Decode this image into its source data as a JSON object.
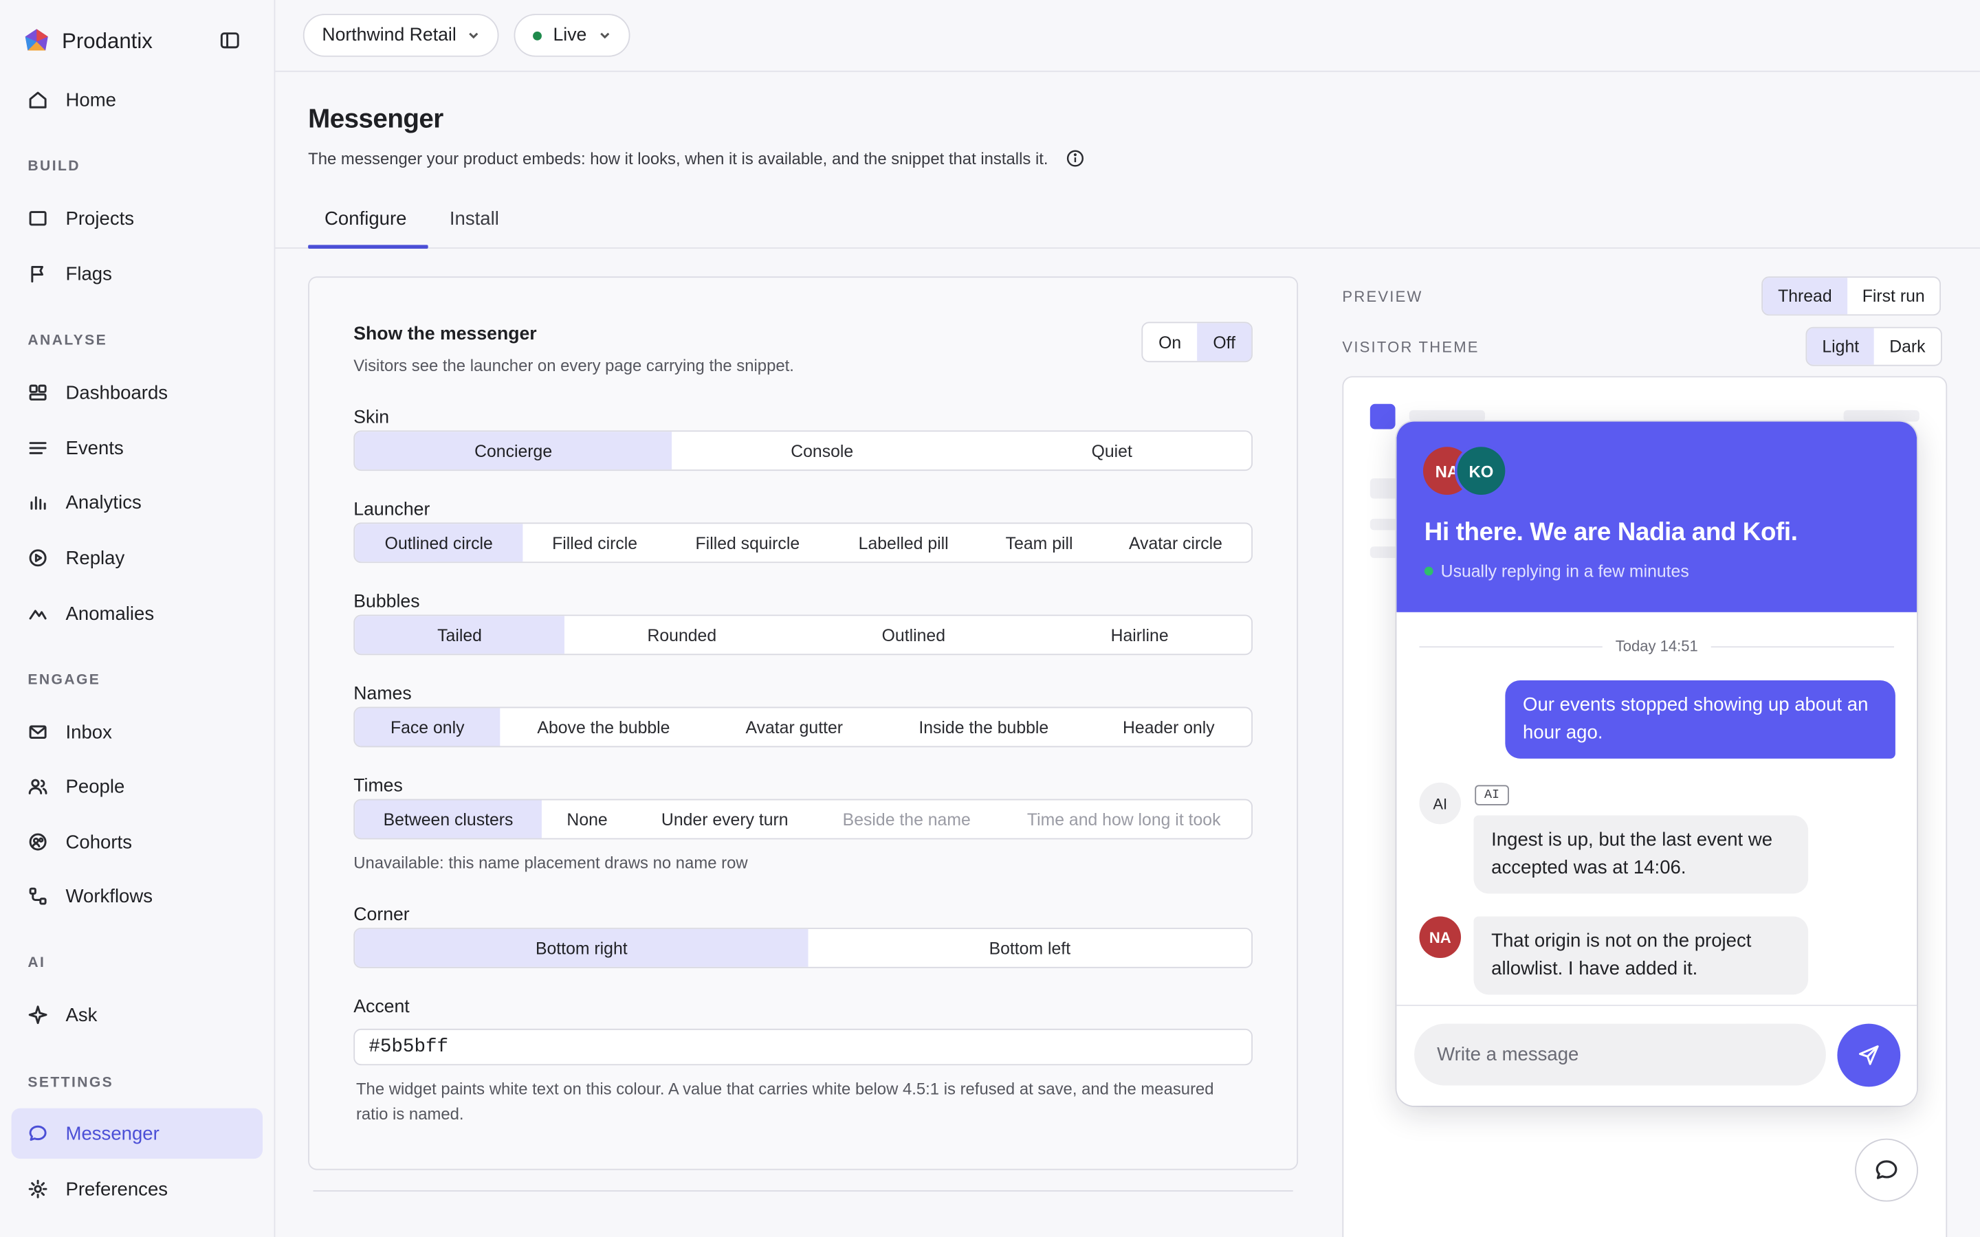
{
  "app": {
    "name": "Prodantix"
  },
  "sidebar": {
    "home": "Home",
    "sections": {
      "build": "BUILD",
      "analyse": "ANALYSE",
      "engage": "ENGAGE",
      "ai": "AI",
      "settings": "SETTINGS"
    },
    "items": {
      "projects": "Projects",
      "flags": "Flags",
      "dashboards": "Dashboards",
      "events": "Events",
      "analytics": "Analytics",
      "replay": "Replay",
      "anomalies": "Anomalies",
      "inbox": "Inbox",
      "people": "People",
      "cohorts": "Cohorts",
      "workflows": "Workflows",
      "ask": "Ask",
      "messenger": "Messenger",
      "preferences": "Preferences"
    },
    "active": "Messenger"
  },
  "topbar": {
    "workspace": "Northwind Retail",
    "environment": "Live"
  },
  "page": {
    "title": "Messenger",
    "subtitle": "The messenger your product embeds: how it looks, when it is available, and the snippet that installs it.",
    "tabs": [
      "Configure",
      "Install"
    ],
    "active_tab": "Configure"
  },
  "form": {
    "show": {
      "label": "Show the messenger",
      "hint": "Visitors see the launcher on every page carrying the snippet.",
      "options": [
        "On",
        "Off"
      ],
      "selected": "Off"
    },
    "skin": {
      "label": "Skin",
      "options": [
        "Concierge",
        "Console",
        "Quiet"
      ],
      "selected": "Concierge"
    },
    "launcher": {
      "label": "Launcher",
      "options": [
        "Outlined circle",
        "Filled circle",
        "Filled squircle",
        "Labelled pill",
        "Team pill",
        "Avatar circle"
      ],
      "selected": "Outlined circle"
    },
    "bubbles": {
      "label": "Bubbles",
      "options": [
        "Tailed",
        "Rounded",
        "Outlined",
        "Hairline"
      ],
      "selected": "Tailed"
    },
    "names": {
      "label": "Names",
      "options": [
        "Face only",
        "Above the bubble",
        "Avatar gutter",
        "Inside the bubble",
        "Header only"
      ],
      "selected": "Face only"
    },
    "times": {
      "label": "Times",
      "options": [
        "Between clusters",
        "None",
        "Under every turn",
        "Beside the name",
        "Time and how long it took"
      ],
      "selected": "Between clusters",
      "disabled": [
        "Beside the name",
        "Time and how long it took"
      ],
      "note": "Unavailable: this name placement draws no name row"
    },
    "corner": {
      "label": "Corner",
      "options": [
        "Bottom right",
        "Bottom left"
      ],
      "selected": "Bottom right"
    },
    "accent": {
      "label": "Accent",
      "value": "#5b5bff",
      "hint": "The widget paints white text on this colour. A value that carries white below 4.5:1 is refused at save, and the measured ratio is named."
    }
  },
  "preview": {
    "label": "PREVIEW",
    "modes": [
      "Thread",
      "First run"
    ],
    "mode_selected": "Thread",
    "theme_label": "VISITOR THEME",
    "themes": [
      "Light",
      "Dark"
    ],
    "theme_selected": "Light",
    "widget": {
      "avatars": [
        "NA",
        "KO"
      ],
      "greeting": "Hi there. We are Nadia and Kofi.",
      "status": "Usually replying in a few minutes",
      "day_divider": "Today 14:51",
      "messages": [
        {
          "from": "visitor",
          "text": "Our events stopped showing up about an hour ago."
        },
        {
          "from": "ai",
          "avatar": "AI",
          "tag": "AI",
          "text": "Ingest is up, but the last event we accepted was at 14:06."
        },
        {
          "from": "agent",
          "avatar": "NA",
          "text": "That origin is not on the project allowlist. I have added it."
        }
      ],
      "composer_placeholder": "Write a message"
    }
  },
  "colors": {
    "accent": "#5b5bf0",
    "selected_bg": "#e3e3fb",
    "active_nav_text": "#4b4fd6",
    "avatar_na": "#b8373a",
    "avatar_ko": "#0f6b6b"
  }
}
